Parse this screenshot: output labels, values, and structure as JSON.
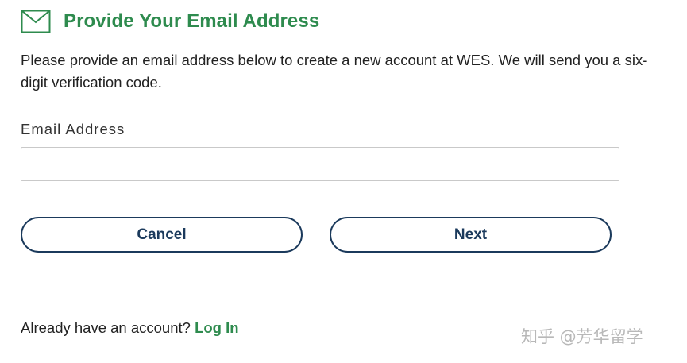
{
  "header": {
    "icon": "envelope-icon",
    "title": "Provide Your Email Address",
    "accent_color": "#2e8b4e"
  },
  "intro": {
    "text": "Please provide an email address below to create a new account at WES. We will send you a six-digit verification code."
  },
  "form": {
    "email_label": "Email Address",
    "email_value": "",
    "email_placeholder": ""
  },
  "buttons": {
    "cancel_label": "Cancel",
    "next_label": "Next",
    "border_color": "#1b3a5c"
  },
  "footer": {
    "prompt": "Already have an account? ",
    "login_label": "Log In"
  },
  "watermark": {
    "text": "知乎 @芳华留学"
  }
}
